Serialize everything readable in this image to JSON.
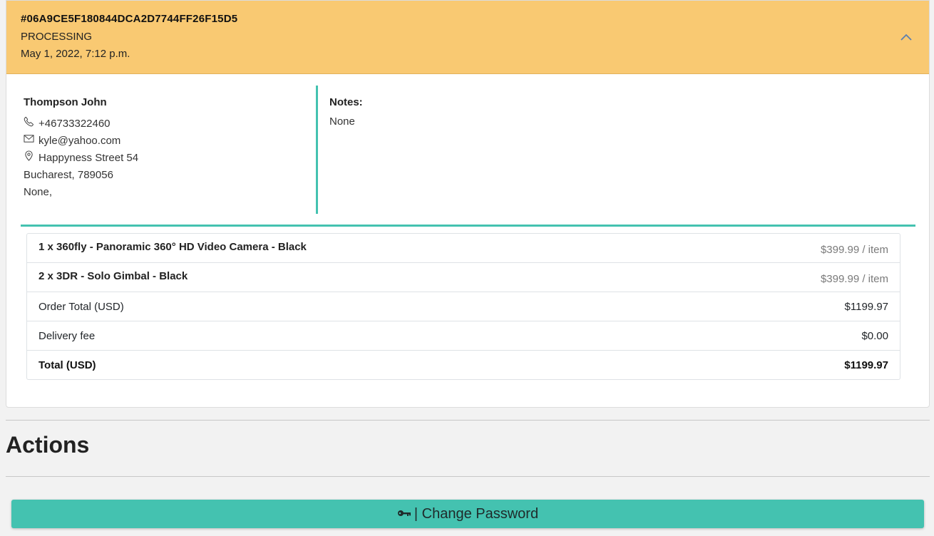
{
  "order": {
    "id": "#06A9CE5F180844DCA2D7744FF26F15D5",
    "status": "PROCESSING",
    "date": "May 1, 2022, 7:12 p.m."
  },
  "customer": {
    "name": "Thompson John",
    "phone": "+46733322460",
    "email": "kyle@yahoo.com",
    "street": "Happyness Street 54",
    "city": "Bucharest, 789056",
    "country": "None,"
  },
  "notes": {
    "label": "Notes:",
    "value": "None"
  },
  "items": [
    {
      "name": "1 x 360fly - Panoramic 360° HD Video Camera - Black",
      "price": "$399.99 / item"
    },
    {
      "name": "2 x 3DR - Solo Gimbal - Black",
      "price": "$399.99 / item"
    }
  ],
  "summary": {
    "order_total_label": "Order Total (USD)",
    "order_total_value": "$1199.97",
    "delivery_label": "Delivery fee",
    "delivery_value": "$0.00",
    "total_label": "Total (USD)",
    "total_value": "$1199.97"
  },
  "actions": {
    "title": "Actions",
    "change_password_label": "| Change Password"
  },
  "icons": {
    "collapse": "chevron-up-icon",
    "phone": "phone-icon",
    "email": "envelope-icon",
    "address": "map-pin-icon",
    "password": "key-icon"
  },
  "colors": {
    "header_bg": "#f9c972",
    "accent": "#44c2b0",
    "page_bg": "#f2f2f2"
  }
}
